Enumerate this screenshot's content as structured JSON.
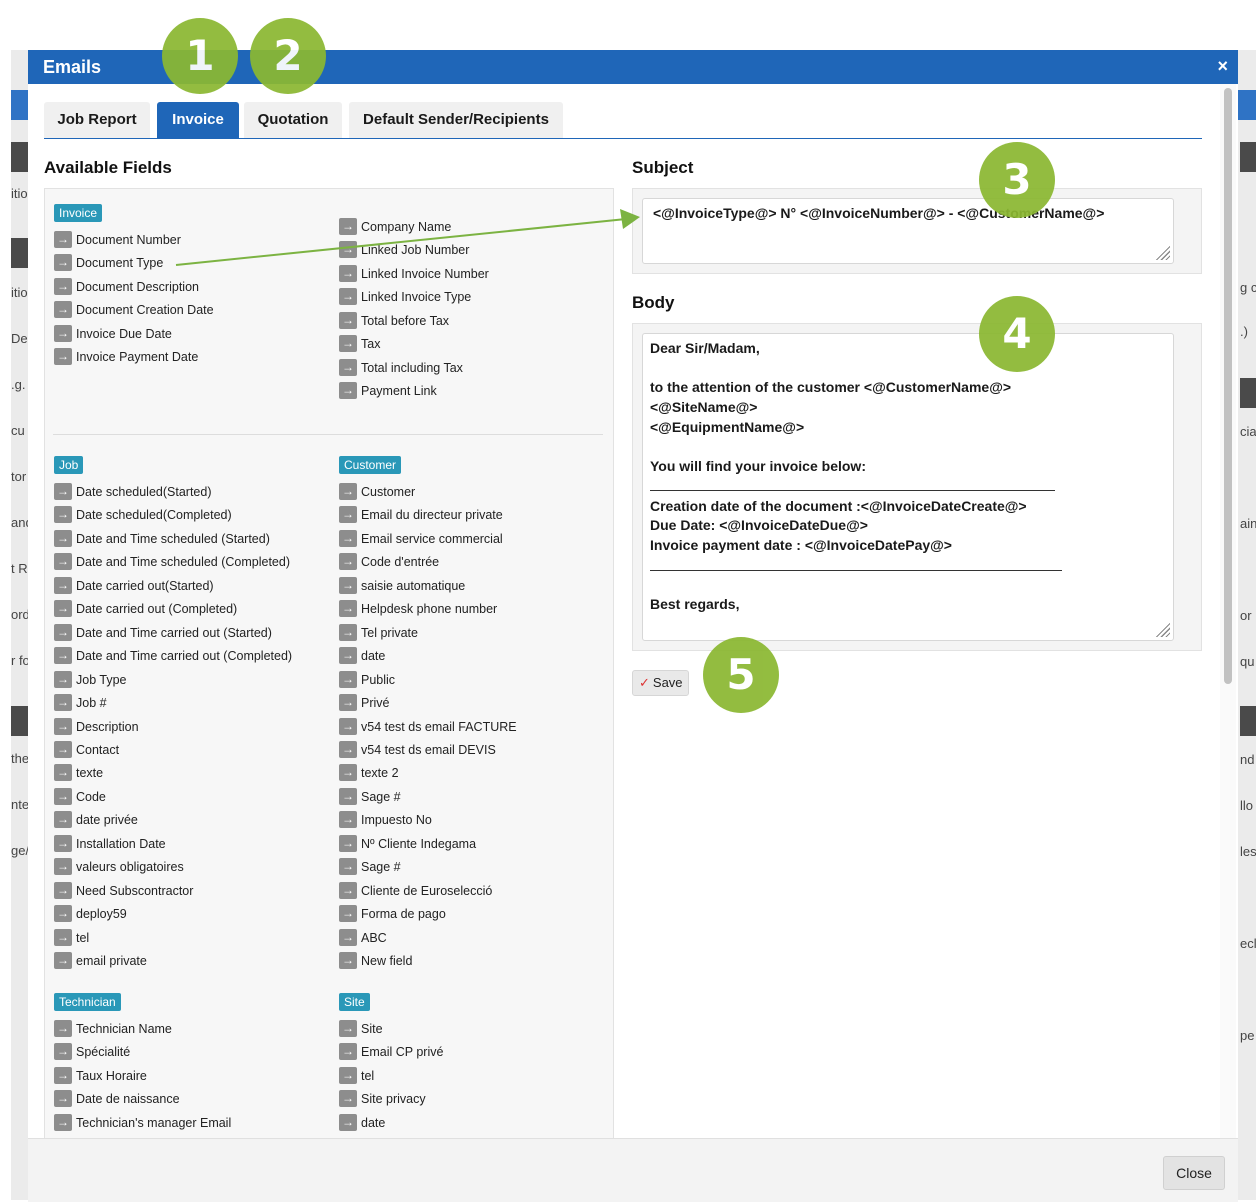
{
  "modal": {
    "title": "Emails",
    "close_glyph": "×"
  },
  "tabs": [
    "Job Report",
    "Invoice",
    "Quotation",
    "Default Sender/Recipients"
  ],
  "active_tab": "Invoice",
  "available_fields": {
    "heading": "Available Fields",
    "groups": {
      "invoice": {
        "label": "Invoice",
        "left": [
          "Document Number",
          "Document Type",
          "Document Description",
          "Document Creation Date",
          "Invoice Due Date",
          "Invoice Payment Date"
        ],
        "right": [
          "Company Name",
          "Linked Job Number",
          "Linked Invoice Number",
          "Linked Invoice Type",
          "Total before Tax",
          "Tax",
          "Total including Tax",
          "Payment Link"
        ]
      },
      "job": {
        "label": "Job",
        "items": [
          "Date scheduled(Started)",
          "Date scheduled(Completed)",
          "Date and Time scheduled (Started)",
          "Date and Time scheduled (Completed)",
          "Date carried out(Started)",
          "Date carried out (Completed)",
          "Date and Time carried out (Started)",
          "Date and Time carried out (Completed)",
          "Job Type",
          "Job #",
          "Description",
          "Contact",
          "texte",
          "Code",
          "date privée",
          "Installation Date",
          "valeurs obligatoires",
          "Need Subscontractor",
          "deploy59",
          "tel",
          "email private"
        ]
      },
      "customer": {
        "label": "Customer",
        "items": [
          "Customer",
          "Email du directeur private",
          "Email service commercial",
          "Code d'entrée",
          "saisie automatique",
          "Helpdesk phone number",
          "Tel private",
          "date",
          "Public",
          "Privé",
          "v54 test ds email FACTURE",
          "v54 test ds email DEVIS",
          "texte 2",
          "Sage #",
          "Impuesto No",
          "Nº Cliente Indegama",
          "Sage #",
          "Cliente de Euroselecció",
          "Forma de pago",
          "ABC",
          "New field"
        ]
      },
      "technician": {
        "label": "Technician",
        "items": [
          "Technician Name",
          "Spécialité",
          "Taux Horaire",
          "Date de naissance",
          "Technician's manager Email"
        ]
      },
      "site": {
        "label": "Site",
        "items": [
          "Site",
          "Email CP privé",
          "tel",
          "Site privacy",
          "date"
        ]
      }
    }
  },
  "subject": {
    "heading": "Subject",
    "value": "<@InvoiceType@>  N° <@InvoiceNumber@>  - <@CustomerName@>"
  },
  "body": {
    "heading": "Body",
    "lines": [
      "Dear Sir/Madam,",
      "",
      "to the attention of the customer <@CustomerName@>",
      "<@SiteName@>",
      "<@EquipmentName@>",
      "",
      "You will find your invoice below:",
      "",
      "Creation date of the document :<@InvoiceDateCreate@>",
      "Due Date: <@InvoiceDateDue@>",
      "Invoice payment date : <@InvoiceDatePay@>",
      "",
      "",
      "Best regards,"
    ]
  },
  "buttons": {
    "save": "Save",
    "close": "Close"
  },
  "callouts": [
    "1",
    "2",
    "3",
    "4",
    "5"
  ],
  "arrow_glyph": "→",
  "colors": {
    "primary": "#1f66b8",
    "badge": "#2a98b8",
    "callout": "#8bb832",
    "annotation_line": "#7cb342"
  },
  "background_fragments": {
    "left": [
      "itio",
      "itio",
      "De",
      ".g.",
      "cu",
      "tor",
      "and",
      "t R",
      "ord",
      "r fo",
      "the",
      "nte",
      "ge/"
    ],
    "right": [
      "g c",
      ".)",
      "cia",
      "ain",
      "or",
      "qu",
      "nd",
      "llo",
      "les",
      "ecl",
      "pe"
    ]
  }
}
